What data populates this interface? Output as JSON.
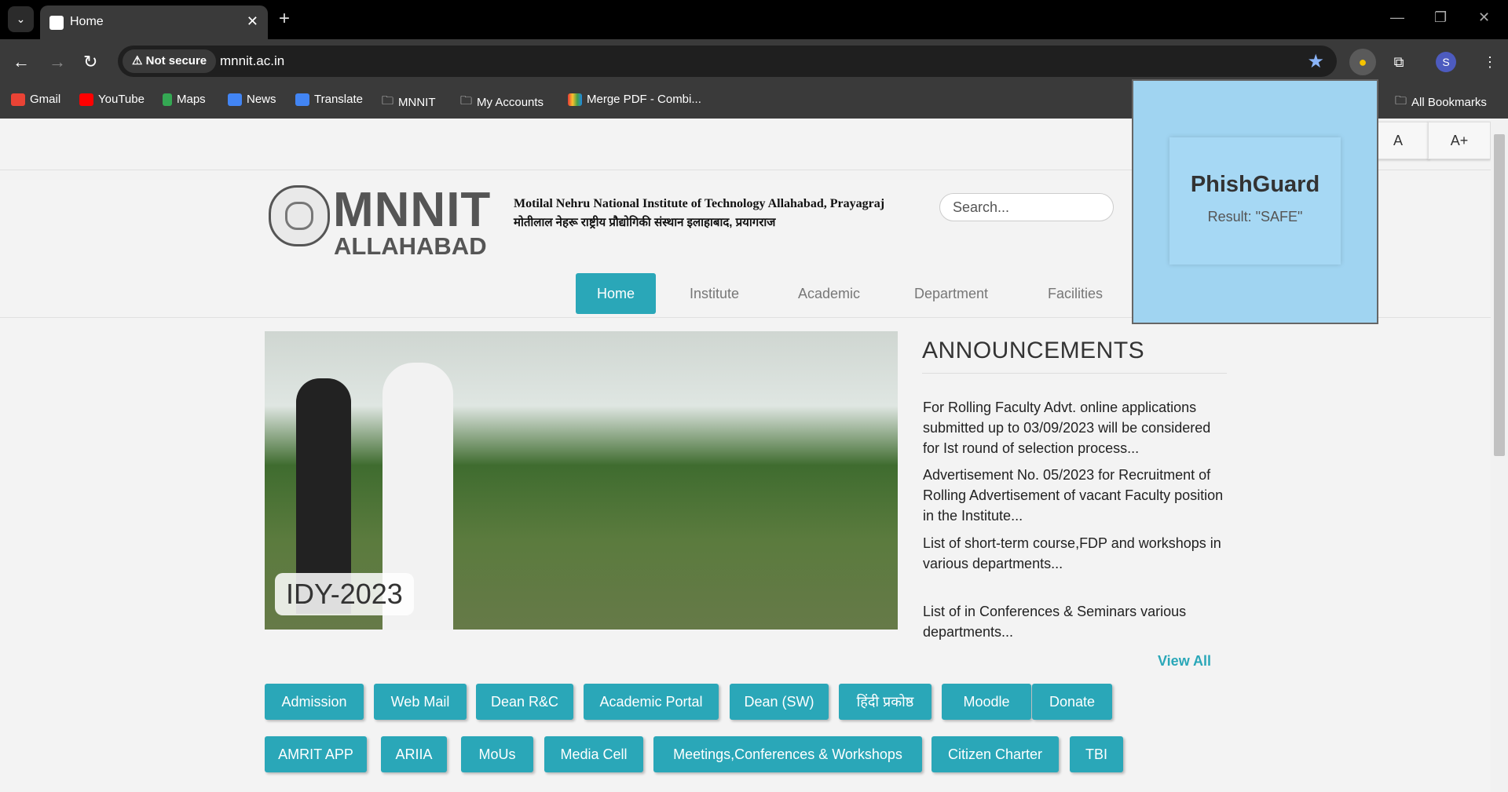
{
  "browser": {
    "tab_title": "Home",
    "url": "mnnit.ac.in",
    "security_label": "Not secure",
    "bookmarks": [
      "Gmail",
      "YouTube",
      "Maps",
      "News",
      "Translate",
      "MNNIT",
      "My Accounts",
      "Merge PDF - Combi...",
      "All Bookmarks"
    ]
  },
  "site": {
    "logo_main": "MNNIT",
    "logo_sub": "ALLAHABAD",
    "institute_en": "Motilal Nehru National Institute of Technology Allahabad, Prayagraj",
    "institute_hi": "मोतीलाल नेहरू राष्ट्रीय प्रौद्योगिकी संस्थान इलाहाबाद, प्रयागराज",
    "search_placeholder": "Search...",
    "font_small": "A",
    "font_large": "A+",
    "nav": [
      "Home",
      "Institute",
      "Academic",
      "Department",
      "Facilities"
    ],
    "hero_caption": "IDY-2023",
    "announcements_title": "ANNOUNCEMENTS",
    "announcements": [
      "For Rolling Faculty Advt. online applications submitted up to 03/09/2023 will be considered for Ist round of selection process...",
      "Advertisement No. 05/2023 for Recruitment of Rolling Advertisement of vacant Faculty position in the Institute...",
      "List of short-term course,FDP and workshops in various departments...",
      "List of in Conferences & Seminars various departments..."
    ],
    "view_all": "View All",
    "quick_links_row1": [
      "Admission",
      "Web Mail",
      "Dean R&C",
      "Academic Portal",
      "Dean (SW)",
      "हिंदी प्रकोष्ठ",
      "Moodle",
      "Donate"
    ],
    "quick_links_row2": [
      "AMRIT APP",
      "ARIIA",
      "MoUs",
      "Media Cell",
      "Meetings,Conferences & Workshops",
      "Citizen Charter",
      "TBI"
    ]
  },
  "phishguard": {
    "title": "PhishGuard",
    "result": "Result: \"SAFE\""
  },
  "colors": {
    "accent": "#2aa7b8",
    "popup_bg": "#a0d4f1"
  }
}
